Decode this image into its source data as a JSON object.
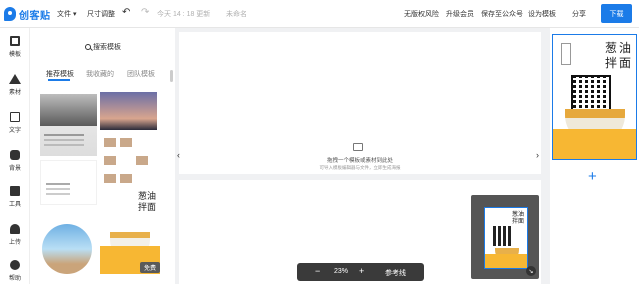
{
  "app": {
    "logo_text": "创客贴"
  },
  "topbar": {
    "file_label": "文件 ▾",
    "resize_label": "尺寸调整",
    "saved_status": "今天 14 : 18 更新",
    "page_name": "未命名",
    "copyright_label": "无版权风险",
    "upgrade_label": "升级会员",
    "save_mp_label": "保存至公众号",
    "set_template_label": "设为模板",
    "share_label": "分享",
    "download_label": "下载"
  },
  "rail": {
    "items": [
      {
        "label": "模板",
        "icon": "template-icon"
      },
      {
        "label": "素材",
        "icon": "shapes-icon"
      },
      {
        "label": "文字",
        "icon": "text-icon"
      },
      {
        "label": "背景",
        "icon": "background-icon"
      },
      {
        "label": "工具",
        "icon": "toolbox-icon"
      },
      {
        "label": "上传",
        "icon": "upload-icon"
      },
      {
        "label": "帮助",
        "icon": "help-icon"
      }
    ]
  },
  "panel": {
    "search_label": "搜索模板",
    "tabs": [
      "推荐模板",
      "我收藏的",
      "团队模板"
    ],
    "free_badge": "免费",
    "template_title": "葱油拌面"
  },
  "canvas": {
    "hint": "拖拽一个模板或素材到此处",
    "sub_hint": "可导入模板编辑器与文件，立即生成海报",
    "zoom": "23%",
    "zoom_minus": "−",
    "zoom_plus": "+",
    "reference_label": "参考线"
  },
  "pages": {
    "add_label": "+"
  },
  "colors": {
    "accent": "#1b7be8",
    "band": "#f7b733"
  }
}
